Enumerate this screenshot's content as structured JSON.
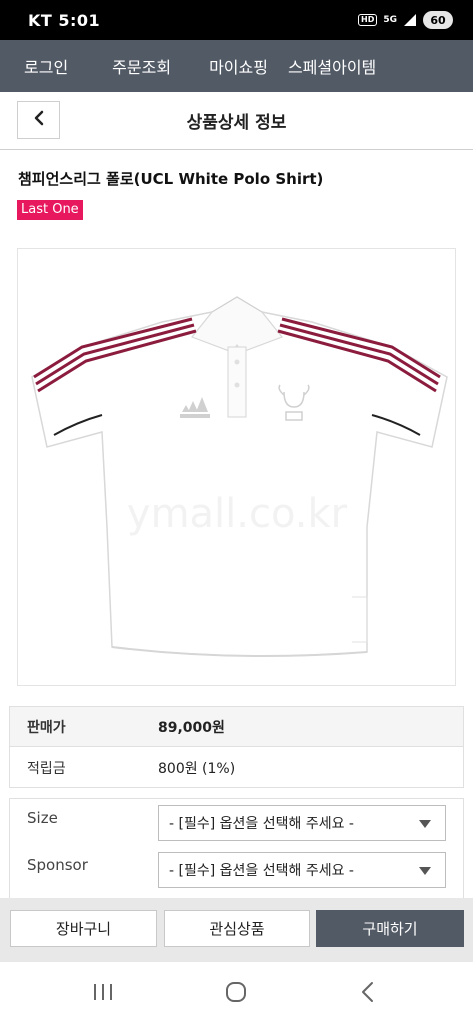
{
  "status_bar": {
    "carrier_time": "KT 5:01",
    "hd_label": "HD",
    "network_label": "5G",
    "battery_level": "60"
  },
  "top_nav": {
    "items": [
      "로그인",
      "주문조회",
      "마이쇼핑",
      "스페셜아이템"
    ]
  },
  "header": {
    "title": "상품상세 정보",
    "back_icon": "chevron-left-icon"
  },
  "product": {
    "name": "챔피언스리그 폴로(UCL White Polo Shirt)",
    "badge": "Last One",
    "badge_color": "#e8185e",
    "image_icon": "polo-shirt-image"
  },
  "price_table": {
    "sale_price_label": "판매가",
    "sale_price_value": "89,000원",
    "points_label": "적립금",
    "points_value": "800원 (1%)"
  },
  "options": [
    {
      "label": "Size",
      "selected": "- [필수] 옵션을 선택해 주세요 -"
    },
    {
      "label": "Sponsor",
      "selected": "- [필수] 옵션을 선택해 주세요 -"
    }
  ],
  "actions": {
    "cart": "장바구니",
    "wishlist": "관심상품",
    "buy": "구매하기",
    "buy_color": "#525a66"
  },
  "system_nav": {
    "recent_icon": "recent-apps-icon",
    "home_icon": "home-icon",
    "back_icon": "back-icon"
  }
}
